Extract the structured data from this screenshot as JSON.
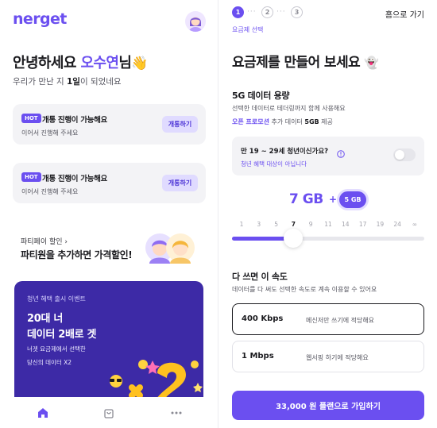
{
  "colors": {
    "brand": "#6b4ff0",
    "brand_light": "#e0dbff",
    "event_bg": "#3d2aa6",
    "card_bg": "#f3f3f6",
    "text": "#1b1b1f"
  },
  "home": {
    "logo": "nerget",
    "greeting_prefix": "안녕하세요 ",
    "user_name": "오수연",
    "greeting_suffix": "님",
    "greeting_emoji": "👋",
    "met_prefix": "우리가 만난 지 ",
    "met_days": "1일",
    "met_suffix": "이 되었네요",
    "hot_cards": [
      {
        "badge": "HOT",
        "title": "개통 진행이 가능해요",
        "subtitle": "이어서 진행해 주세요",
        "button": "개통하기"
      },
      {
        "badge": "HOT",
        "title": "개통 진행이 가능해요",
        "subtitle": "이어서 진행해 주세요",
        "button": "개통하기"
      }
    ],
    "party_discount": {
      "label": "파티페이 할인",
      "arrow": "›",
      "headline": "파티원을 추가하면 가격할인!"
    },
    "event": {
      "tag": "청년 혜택 출시 이벤트",
      "title_line1": "20대 너",
      "title_line2": "데이터 2배로 겟",
      "sub_line1": "너겟 요금제에서 선택한",
      "sub_line2": "당신의 데이터 X2",
      "art_text": "x2"
    },
    "bottom_nav": [
      {
        "name": "home",
        "icon": "home-icon",
        "active": true
      },
      {
        "name": "shop",
        "icon": "shopping-bag-icon",
        "active": false
      },
      {
        "name": "more",
        "icon": "more-icon",
        "active": false
      }
    ]
  },
  "plan": {
    "steps": [
      {
        "number": "1",
        "active": true
      },
      {
        "number": "2",
        "active": false
      },
      {
        "number": "3",
        "active": false
      }
    ],
    "step_separator": "···",
    "step_label": "요금제 선택",
    "home_link": "홈으로 가기",
    "title": "요금제를 만들어 보세요",
    "title_emoji": "👻",
    "data_section": {
      "title": "5G 데이터 용량",
      "description": "선택한 데이터로 테더링까지 함께 사용해요",
      "promo_highlight": "오픈 프로모션",
      "promo_middle": " 추가 데이터 ",
      "promo_amount": "5GB",
      "promo_suffix": " 제공"
    },
    "youth_check": {
      "question": "만 19 ~ 29세 청년이신가요?",
      "note": "청년 혜택 대상이 아닙니다",
      "toggle_on": false
    },
    "data_value": "7 GB",
    "plus_sign": "+",
    "bonus_value": "5 GB",
    "slider": {
      "ticks": [
        "1",
        "3",
        "5",
        "7",
        "9",
        "11",
        "14",
        "17",
        "19",
        "24",
        "∞"
      ],
      "selected_index": 3
    },
    "speed_section": {
      "title": "다 쓰면 이 속도",
      "description": "데이터를 다 써도 선택한 속도로 계속 이용할 수 있어요",
      "options": [
        {
          "speed": "400 Kbps",
          "desc": "메신저만 쓰기에 적당해요",
          "selected": true
        },
        {
          "speed": "1 Mbps",
          "desc": "웹서핑 하기에 적당해요",
          "selected": false
        }
      ]
    },
    "cta": "33,000 원 플랜으로 가입하기"
  }
}
